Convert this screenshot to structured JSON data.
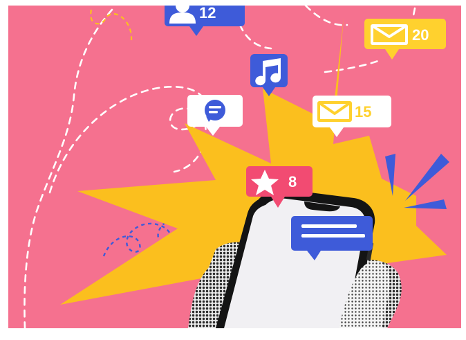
{
  "colors": {
    "background": "#f5718f",
    "star_burst": "#fbbf1e",
    "blue_bubble": "#3e5bd9",
    "white_bubble": "#ffffff",
    "yellow_bubble": "#ffd12e",
    "pink_bubble": "#f24b72",
    "phone_screen": "#f1f0f3",
    "phone_body": "#141414"
  },
  "notifications": {
    "followers": {
      "icon": "user-icon",
      "count": "12"
    },
    "music": {
      "icon": "music-note-icon"
    },
    "message": {
      "icon": "chat-bubble-icon"
    },
    "mail_top": {
      "icon": "mail-icon",
      "count": "20"
    },
    "mail_mid": {
      "icon": "mail-icon",
      "count": "15"
    },
    "favorites": {
      "icon": "star-icon",
      "count": "8"
    },
    "text_bubble": {
      "icon": "text-lines-icon"
    }
  }
}
